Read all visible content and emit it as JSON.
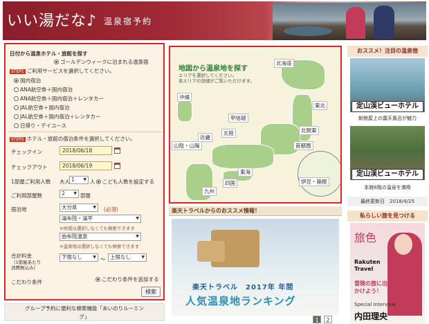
{
  "header": {
    "logo_main": "いい湯だな♪",
    "logo_sub": "温泉宿予約"
  },
  "search": {
    "title": "日付から温泉ホテル・旅館を探す",
    "golden_week": "ゴールデンウィークに泊まれる温泉宿",
    "step1_label": "STEP1",
    "step1_text": "ご利用サービスを選択してください。",
    "services": [
      "国内宿泊",
      "ANA航空券＋国内宿泊",
      "ANA航空券＋国内宿泊＋レンタカー",
      "JAL航空券＋国内宿泊",
      "JAL航空券＋国内宿泊＋レンタカー",
      "日帰り・デイユース"
    ],
    "step2_label": "STEP2",
    "step2_text": "ホテル・旅館の宿泊条件を選択してください。",
    "checkin_label": "チェックイン",
    "checkin_value": "2018/06/18",
    "checkout_label": "チェックアウト",
    "checkout_value": "2018/06/19",
    "guests_label": "1部屋ご利用人数",
    "adult_label": "大人",
    "adult_value": "1",
    "person_unit": "人",
    "child_label": "こども人数を設定する",
    "rooms_label": "ご利用部屋数",
    "rooms_value": "2",
    "rooms_unit": "部屋",
    "area_label": "宿泊地",
    "pref_value": "大分県",
    "required": "(必須)",
    "area1_value": "湯布院・湯平",
    "area1_note": "※地域は選択しなくても検索できます",
    "area2_value": "由布院温泉",
    "area2_note": "※温泉地は選択しなくても検索できます",
    "price_label": "合計料金",
    "price_sub1": "（1部屋あたり",
    "price_sub2": "消費税込み）",
    "price_min": "下限なし",
    "price_sep": "〜",
    "price_max": "上限なし",
    "kodawari_label": "こだわり条件",
    "kodawari_add": "こだわり条件を追加する",
    "search_button": "検索"
  },
  "group": {
    "line1": "グループ予約に便利な検索機能「あいのりルーミン",
    "line2": "グ」"
  },
  "map": {
    "title": "地図から温泉地を探す",
    "desc1": "エリアを選択してください。",
    "desc2": "各エリアの詳細がご覧いただけます。",
    "regions": {
      "hokkaido": "北海道",
      "tohoku": "東北",
      "kitakanto": "北関東",
      "shutoken": "首都圏",
      "koshinetsu": "甲信越",
      "hokuriku": "北陸",
      "kinki": "近畿",
      "sanin": "山陰・山陽",
      "shikoku": "四国",
      "kyushu": "九州",
      "tokai": "東海",
      "izu": "伊豆・箱根",
      "okinawa": "沖縄"
    }
  },
  "recommend": {
    "head": "楽天トラベルからのおススメ情報！",
    "sub": "楽天トラベル　2017年 年間",
    "big": "人気温泉地ランキング",
    "page1": "1",
    "page2": "2"
  },
  "right": {
    "head": "おススメ！注目の温泉宿",
    "hotel_sign": "定山渓ビューホテル",
    "cap1": "新館屋上の露天風呂が魅力",
    "cap2": "本館8階の温泉を満喫",
    "updated_label": "最終更新日",
    "updated_value": "2018/4/25",
    "head2": "私らしい旅を見つける",
    "mag_title": "旅色",
    "mag_rakuten1": "Rakuten",
    "mag_rakuten2": "Travel",
    "mag_special": "Special Interview",
    "mag_name": "内田理央",
    "mag_catch": "冒険の旅に出かけよう！"
  }
}
